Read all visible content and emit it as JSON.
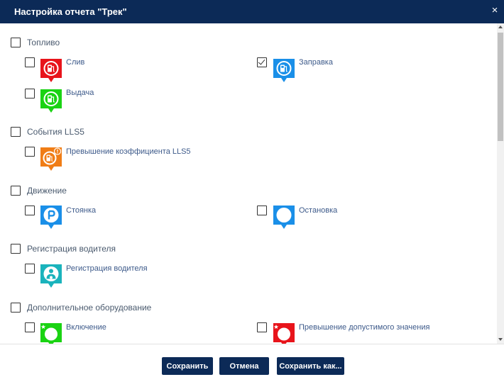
{
  "dialog": {
    "title": "Настройка отчета \"Трек\"",
    "close_symbol": "×"
  },
  "groups": [
    {
      "label": "Топливо",
      "checked": false,
      "items": [
        {
          "label": "Слив",
          "checked": false,
          "color": "#e8141b",
          "icon": "fuel-pump-icon"
        },
        {
          "label": "Заправка",
          "checked": true,
          "color": "#1a8fe8",
          "icon": "fuel-pump-icon"
        },
        {
          "label": "Выдача",
          "checked": false,
          "color": "#1ad313",
          "icon": "fuel-pump-icon"
        }
      ]
    },
    {
      "label": "События LLS5",
      "checked": false,
      "items": [
        {
          "label": "Превышение коэффициента LLS5",
          "checked": false,
          "color": "#f07d16",
          "icon": "fuel-pump-warning-icon"
        }
      ]
    },
    {
      "label": "Движение",
      "checked": false,
      "items": [
        {
          "label": "Стоянка",
          "checked": false,
          "color": "#1a8fe8",
          "icon": "parking-icon"
        },
        {
          "label": "Остановка",
          "checked": false,
          "color": "#1a8fe8",
          "icon": "circle-icon"
        }
      ]
    },
    {
      "label": "Регистрация водителя",
      "checked": false,
      "items": [
        {
          "label": "Регистрация водителя",
          "checked": false,
          "color": "#1ab3bc",
          "icon": "driver-icon"
        }
      ]
    },
    {
      "label": "Дополнительное оборудование",
      "checked": false,
      "items": [
        {
          "label": "Включение",
          "checked": false,
          "color": "#1ad313",
          "icon": "circle-star-icon"
        },
        {
          "label": "Превышение допустимого значения",
          "checked": false,
          "color": "#e8141b",
          "icon": "circle-star-icon"
        }
      ]
    }
  ],
  "buttons": {
    "save": "Сохранить",
    "cancel": "Отмена",
    "save_as": "Сохранить как..."
  }
}
